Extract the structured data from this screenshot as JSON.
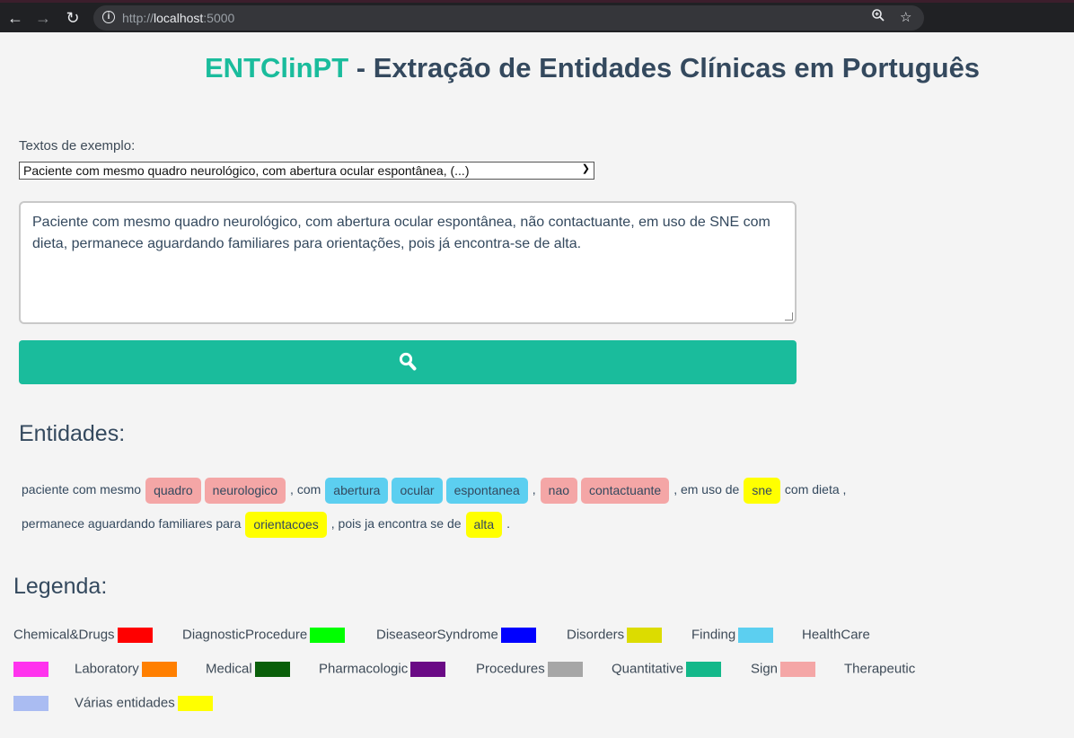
{
  "browser": {
    "url_scheme": "http://",
    "url_host": "localhost",
    "url_port": ":5000"
  },
  "header": {
    "brand": "ENTClinPT",
    "title_rest": " - Extração de Entidades Clínicas em Português"
  },
  "examples": {
    "label": "Textos de exemplo:",
    "selected": "Paciente com mesmo quadro neurológico, com abertura ocular espontânea, (...)"
  },
  "input": {
    "text": "Paciente com mesmo quadro neurológico, com abertura ocular espontânea, não contactuante, em uso de SNE com dieta, permanece aguardando familiares para orientações, pois já encontra-se de alta."
  },
  "entities": {
    "title": "Entidades:",
    "tokens": [
      {
        "text": "paciente com mesmo",
        "color": null
      },
      {
        "text": "quadro",
        "color": "#f4a6a6"
      },
      {
        "text": "neurologico",
        "color": "#f4a6a6"
      },
      {
        "text": ", com",
        "color": null
      },
      {
        "text": "abertura",
        "color": "#5ccff0"
      },
      {
        "text": "ocular",
        "color": "#5ccff0"
      },
      {
        "text": "espontanea",
        "color": "#5ccff0"
      },
      {
        "text": ",",
        "color": null
      },
      {
        "text": "nao",
        "color": "#f4a6a6"
      },
      {
        "text": "contactuante",
        "color": "#f4a6a6"
      },
      {
        "text": ", em uso de",
        "color": null
      },
      {
        "text": "sne",
        "color": "#ffff00"
      },
      {
        "text": "com dieta ,",
        "color": null
      },
      {
        "text": "permanece aguardando familiares para",
        "color": null
      },
      {
        "text": "orientacoes",
        "color": "#ffff00"
      },
      {
        "text": ", pois ja encontra se de",
        "color": null
      },
      {
        "text": "alta",
        "color": "#ffff00"
      },
      {
        "text": ".",
        "color": null
      }
    ]
  },
  "legend": {
    "title": "Legenda:",
    "items": [
      {
        "label": "Chemical&Drugs",
        "color": "#ff0000"
      },
      {
        "label": "DiagnosticProcedure",
        "color": "#00ff00"
      },
      {
        "label": "DiseaseorSyndrome",
        "color": "#0000ff"
      },
      {
        "label": "Disorders",
        "color": "#dcdc00"
      },
      {
        "label": "Finding",
        "color": "#5ccff0"
      },
      {
        "label": "HealthCare",
        "color": "#ff33ee"
      },
      {
        "label": "Laboratory",
        "color": "#ff7f00"
      },
      {
        "label": "Medical",
        "color": "#0a5f0a"
      },
      {
        "label": "Pharmacologic",
        "color": "#6a0a85"
      },
      {
        "label": "Procedures",
        "color": "#a6a6a6"
      },
      {
        "label": "Quantitative",
        "color": "#14b88a"
      },
      {
        "label": "Sign",
        "color": "#f4a6a6"
      },
      {
        "label": "Therapeutic",
        "color": "#aabcf2"
      },
      {
        "label": "Várias entidades",
        "color": "#ffff00"
      }
    ]
  }
}
